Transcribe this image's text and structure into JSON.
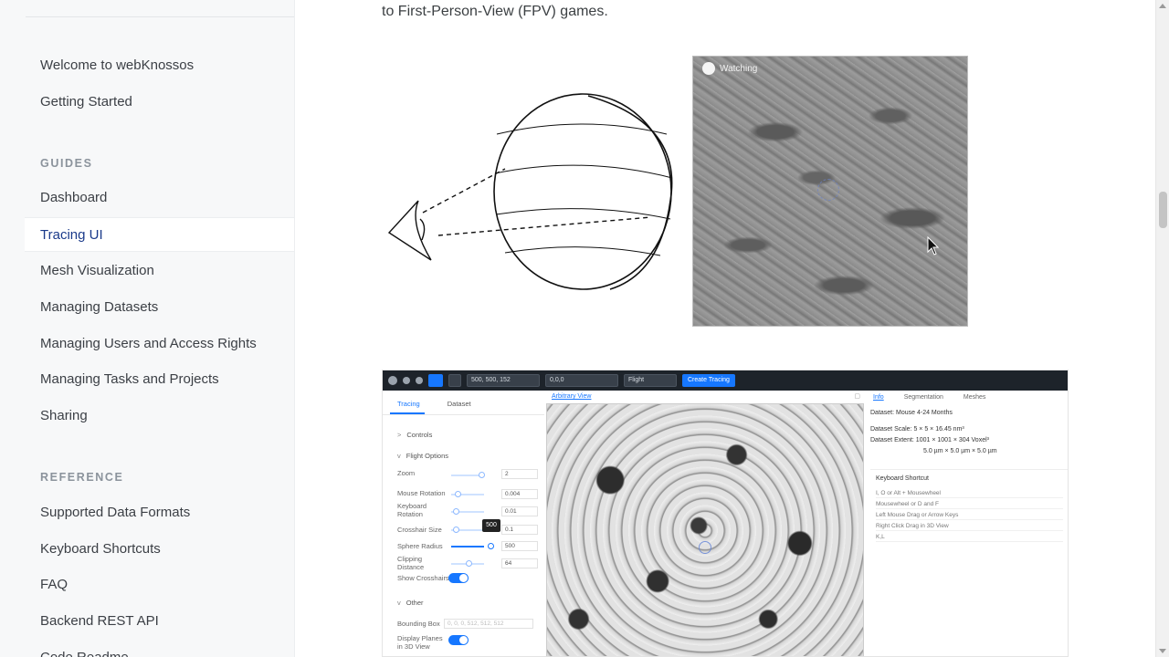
{
  "sidebar": {
    "items_top": [
      {
        "label": "Welcome to webKnossos"
      },
      {
        "label": "Getting Started"
      }
    ],
    "guides_heading": "GUIDES",
    "guides": [
      {
        "label": "Dashboard"
      },
      {
        "label": "Tracing UI",
        "active": true
      },
      {
        "label": "Mesh Visualization"
      },
      {
        "label": "Managing Datasets"
      },
      {
        "label": "Managing Users and Access Rights"
      },
      {
        "label": "Managing Tasks and Projects"
      },
      {
        "label": "Sharing"
      }
    ],
    "reference_heading": "REFERENCE",
    "reference": [
      {
        "label": "Supported Data Formats"
      },
      {
        "label": "Keyboard Shortcuts"
      },
      {
        "label": "FAQ"
      },
      {
        "label": "Backend REST API"
      },
      {
        "label": "Code Readme"
      }
    ]
  },
  "main": {
    "intro_text": "to First-Person-View (FPV) games.",
    "thumb_watch_label": "Watching"
  },
  "app": {
    "toolbar": {
      "position": "500, 500, 152",
      "rotation": "0,0,0",
      "mode": "Flight",
      "create_label": "Create Tracing"
    },
    "left_tabs": [
      "Tracing",
      "Dataset"
    ],
    "controls_label": "Controls",
    "flight_options_label": "Flight Options",
    "settings": [
      {
        "label": "Zoom",
        "value": "2"
      },
      {
        "label": "Mouse Rotation",
        "value": "0.004"
      },
      {
        "label": "Keyboard Rotation",
        "value": "0.01"
      },
      {
        "label": "Crosshair Size",
        "value": "0.1"
      },
      {
        "label": "Sphere Radius",
        "value": "500"
      },
      {
        "label": "Clipping Distance",
        "value": "64"
      }
    ],
    "show_crosshairs_label": "Show Crosshairs",
    "tooltip_value": "500",
    "other_label": "Other",
    "bounding_box_label": "Bounding Box",
    "bounding_box_placeholder": "0, 0, 0, 512, 512, 512",
    "display_planes_label": "Display Planes in 3D View",
    "viewport_title": "Arbitrary View",
    "right_tabs": [
      "Info",
      "Segmentation",
      "Meshes"
    ],
    "info": {
      "dataset": "Dataset: Mouse 4-24 Months",
      "scale": "Dataset Scale: 5 × 5 × 16.45 nm³",
      "extent": "Dataset Extent:  1001 × 1001 × 304 Voxel³",
      "extent2": "5.0 µm × 5.0 µm × 5.0 µm"
    },
    "kb_title": "Keyboard Shortcut",
    "kb_rows": [
      "I, O or Alt + Mousewheel",
      "Mousewheel or D and F",
      "Left Mouse Drag or Arrow Keys",
      "Right Click Drag in 3D View",
      "K,L"
    ]
  },
  "colors": {
    "accent": "#1677ff",
    "sidebar_active": "#1a3a8a",
    "toolbar_bg": "#1d232a"
  }
}
